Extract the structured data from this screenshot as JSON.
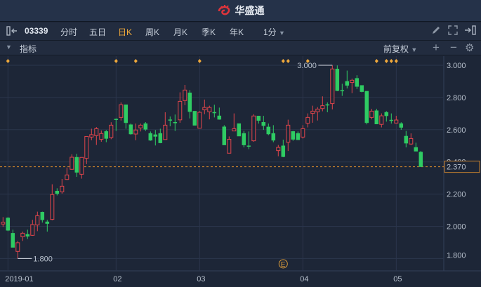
{
  "app": {
    "title": "华盛通",
    "brand_color": "#e0343b"
  },
  "toolbar": {
    "symbol": "03339",
    "tabs": [
      "分时",
      "五日",
      "日K",
      "周K",
      "月K",
      "季K",
      "年K"
    ],
    "active_tab": "日K",
    "interval": "1分"
  },
  "indicator_bar": {
    "label": "指标",
    "adjust": "前复权"
  },
  "chart_data": {
    "type": "candlestick",
    "y_ticks": [
      "3.000",
      "2.800",
      "2.600",
      "2.400",
      "2.200",
      "2.000",
      "1.800"
    ],
    "ylim": [
      1.75,
      3.03
    ],
    "x_labels": [
      {
        "label": "2019-01",
        "index": 1
      },
      {
        "label": "02",
        "index": 23
      },
      {
        "label": "03",
        "index": 40
      },
      {
        "label": "04",
        "index": 61
      },
      {
        "label": "05",
        "index": 80
      }
    ],
    "current_price": "2.370",
    "high_label": "3.000",
    "high_index": 67,
    "low_label": "1.800",
    "low_index": 3,
    "event_marker": "E",
    "event_index": 57,
    "diamond_indices": [
      1,
      23,
      27,
      40,
      57,
      58,
      62,
      76,
      78,
      79,
      80
    ],
    "colors": {
      "up": "#e0454b",
      "down": "#2fcb63",
      "marker": "#f0a93b"
    },
    "candles": [
      [
        2.014,
        2.057,
        1.996,
        2.025
      ],
      [
        2.052,
        2.057,
        1.97,
        1.975
      ],
      [
        1.957,
        1.979,
        1.869,
        1.869
      ],
      [
        1.844,
        1.909,
        1.8,
        1.898
      ],
      [
        1.935,
        1.967,
        1.909,
        1.957
      ],
      [
        1.95,
        1.979,
        1.921,
        1.938
      ],
      [
        1.944,
        2.04,
        1.941,
        2.011
      ],
      [
        2.008,
        2.091,
        1.97,
        2.066
      ],
      [
        2.088,
        2.091,
        2.023,
        2.04
      ],
      [
        2.028,
        2.04,
        1.967,
        2.017
      ],
      [
        2.043,
        2.261,
        2.037,
        2.197
      ],
      [
        2.219,
        2.236,
        2.192,
        2.203
      ],
      [
        2.214,
        2.294,
        2.203,
        2.249
      ],
      [
        2.291,
        2.365,
        2.287,
        2.319
      ],
      [
        2.354,
        2.447,
        2.351,
        2.429
      ],
      [
        2.429,
        2.45,
        2.307,
        2.335
      ],
      [
        2.323,
        2.429,
        2.296,
        2.428
      ],
      [
        2.422,
        2.558,
        2.386,
        2.558
      ],
      [
        2.554,
        2.606,
        2.534,
        2.569
      ],
      [
        2.563,
        2.616,
        2.505,
        2.606
      ],
      [
        2.54,
        2.595,
        2.525,
        2.576
      ],
      [
        2.589,
        2.598,
        2.522,
        2.545
      ],
      [
        2.551,
        2.646,
        2.541,
        2.628
      ],
      [
        2.666,
        2.67,
        2.592,
        2.665
      ],
      [
        2.676,
        2.769,
        2.657,
        2.755
      ],
      [
        2.755,
        2.755,
        2.606,
        2.643
      ],
      [
        2.631,
        2.638,
        2.569,
        2.573
      ],
      [
        2.573,
        2.638,
        2.534,
        2.598
      ],
      [
        2.611,
        2.638,
        2.589,
        2.628
      ],
      [
        2.638,
        2.647,
        2.592,
        2.602
      ],
      [
        2.577,
        2.589,
        2.531,
        2.534
      ],
      [
        2.569,
        2.598,
        2.502,
        2.558
      ],
      [
        2.577,
        2.606,
        2.516,
        2.518
      ],
      [
        2.539,
        2.708,
        2.539,
        2.628
      ],
      [
        2.662,
        2.682,
        2.621,
        2.66
      ],
      [
        2.646,
        2.694,
        2.592,
        2.644
      ],
      [
        2.661,
        2.832,
        2.643,
        2.776
      ],
      [
        2.781,
        2.878,
        2.752,
        2.846
      ],
      [
        2.829,
        2.846,
        2.67,
        2.712
      ],
      [
        2.715,
        2.715,
        2.627,
        2.627
      ],
      [
        2.609,
        2.715,
        2.609,
        2.708
      ],
      [
        2.723,
        2.787,
        2.696,
        2.738
      ],
      [
        2.711,
        2.749,
        2.664,
        2.738
      ],
      [
        2.708,
        2.755,
        2.676,
        2.706
      ],
      [
        2.686,
        2.737,
        2.662,
        2.664
      ],
      [
        2.618,
        2.628,
        2.505,
        2.505
      ],
      [
        2.454,
        2.558,
        2.454,
        2.54
      ],
      [
        2.592,
        2.701,
        2.592,
        2.606
      ],
      [
        2.638,
        2.638,
        2.56,
        2.56
      ],
      [
        2.577,
        2.592,
        2.49,
        2.505
      ],
      [
        2.5,
        2.589,
        2.479,
        2.499
      ],
      [
        2.531,
        2.696,
        2.525,
        2.685
      ],
      [
        2.685,
        2.685,
        2.638,
        2.657
      ],
      [
        2.646,
        2.686,
        2.599,
        2.625
      ],
      [
        2.617,
        2.638,
        2.566,
        2.573
      ],
      [
        2.577,
        2.628,
        2.522,
        2.534
      ],
      [
        2.47,
        2.505,
        2.435,
        2.49
      ],
      [
        2.5,
        2.538,
        2.429,
        2.432
      ],
      [
        2.522,
        2.662,
        2.468,
        2.628
      ],
      [
        2.589,
        2.592,
        2.531,
        2.54
      ],
      [
        2.577,
        2.589,
        2.537,
        2.537
      ],
      [
        2.554,
        2.628,
        2.545,
        2.606
      ],
      [
        2.64,
        2.701,
        2.614,
        2.676
      ],
      [
        2.701,
        2.749,
        2.643,
        2.715
      ],
      [
        2.711,
        2.74,
        2.657,
        2.728
      ],
      [
        2.731,
        2.807,
        2.714,
        2.749
      ],
      [
        2.756,
        2.769,
        2.708,
        2.755
      ],
      [
        2.762,
        2.999,
        2.726,
        2.977
      ],
      [
        2.977,
        2.999,
        2.839,
        2.842
      ],
      [
        2.844,
        2.885,
        2.81,
        2.843
      ],
      [
        2.9,
        2.967,
        2.856,
        2.875
      ],
      [
        2.893,
        2.917,
        2.827,
        2.907
      ],
      [
        2.919,
        2.938,
        2.853,
        2.868
      ],
      [
        2.875,
        2.875,
        2.832,
        2.836
      ],
      [
        2.839,
        2.839,
        2.633,
        2.643
      ],
      [
        2.676,
        2.73,
        2.664,
        2.715
      ],
      [
        2.718,
        2.73,
        2.635,
        2.635
      ],
      [
        2.633,
        2.701,
        2.614,
        2.686
      ],
      [
        2.708,
        2.715,
        2.65,
        2.686
      ],
      [
        2.66,
        2.701,
        2.638,
        2.659
      ],
      [
        2.641,
        2.686,
        2.638,
        2.66
      ],
      [
        2.638,
        2.646,
        2.599,
        2.614
      ],
      [
        2.56,
        2.592,
        2.49,
        2.516
      ],
      [
        2.511,
        2.577,
        2.505,
        2.545
      ],
      [
        2.49,
        2.519,
        2.466,
        2.466
      ],
      [
        2.461,
        2.468,
        2.37,
        2.37
      ]
    ]
  }
}
